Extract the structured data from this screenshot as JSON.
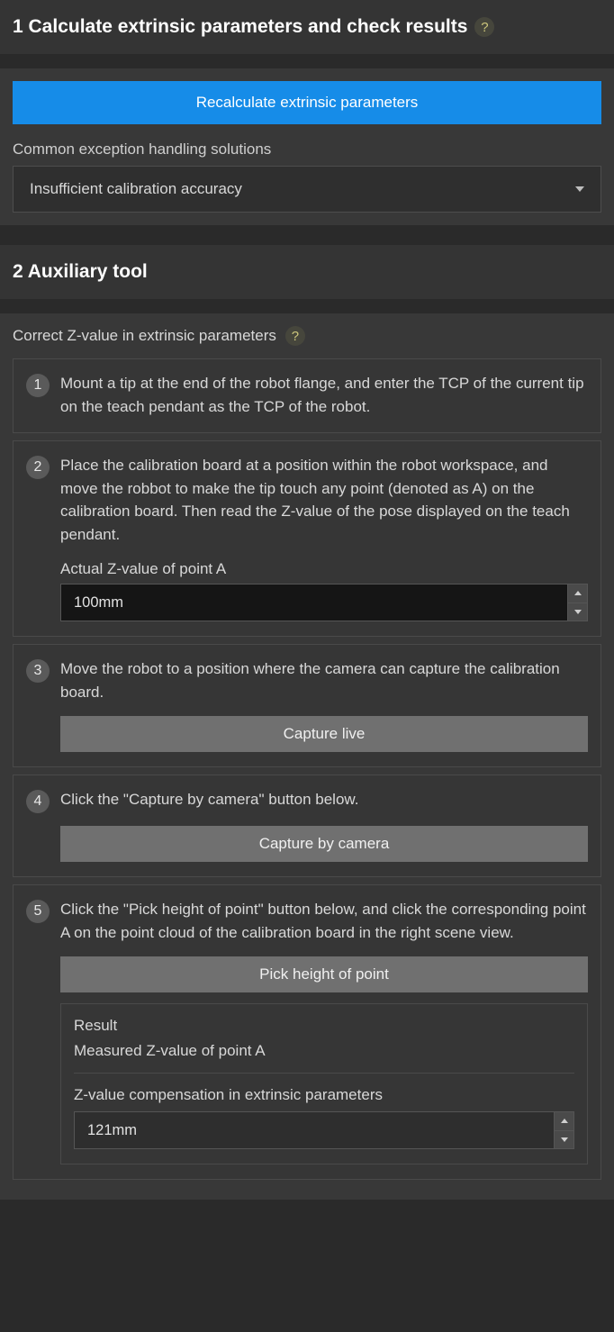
{
  "section1": {
    "title": "1 Calculate extrinsic parameters and check results",
    "help": "?",
    "recalc_button": "Recalculate extrinsic parameters",
    "handling_label": "Common exception handling solutions",
    "handling_value": "Insufficient calibration accuracy"
  },
  "section2": {
    "title": "2 Auxiliary tool",
    "subhead": "Correct Z-value in extrinsic parameters",
    "help": "?",
    "steps": {
      "s1": {
        "num": "1",
        "text": "Mount a tip at the end of the robot flange, and enter the TCP of the current tip on the teach pendant as the TCP of the robot."
      },
      "s2": {
        "num": "2",
        "text": "Place the calibration board at a position within the robot workspace, and move the robbot to make the tip touch any point (denoted as A) on the calibration board. Then read the Z-value of the pose displayed on the teach pendant.",
        "field_label": "Actual Z-value of point A",
        "field_value": "100mm"
      },
      "s3": {
        "num": "3",
        "text": "Move the robot to a position where the camera can capture the calibration board.",
        "button": "Capture live"
      },
      "s4": {
        "num": "4",
        "text": "Click the \"Capture by camera\" button below.",
        "button": "Capture by camera"
      },
      "s5": {
        "num": "5",
        "text": "Click the \"Pick height of point\" button below, and click the corresponding point A on the point cloud of the calibration board in the right scene view.",
        "button": "Pick height of point",
        "result_label": "Result",
        "measured_label": "Measured Z-value of point A",
        "comp_label": "Z-value compensation in extrinsic parameters",
        "comp_value": "121mm"
      }
    }
  }
}
